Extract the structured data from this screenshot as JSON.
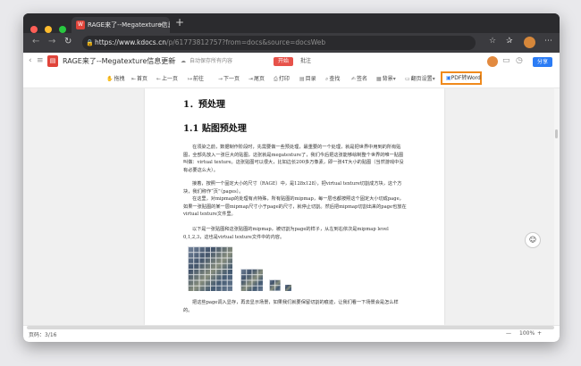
{
  "browser": {
    "tab_title": "RAGE来了--Megatexture信息更新",
    "tab_close": "×",
    "new_tab": "+",
    "url_main": "https://www.kdocs.cn",
    "url_rest": "/p/61773812757?from=docs&source=docsWeb"
  },
  "app": {
    "doc_title": "RAGE来了--Megatexture信息更新",
    "autosave": "自动保存所有内容",
    "open_label": "开始",
    "comment_label": "批注",
    "share_label": "分享"
  },
  "toolbar": {
    "items": [
      "拖拽",
      "首页",
      "上一页",
      "前往",
      "下一页",
      "尾页",
      "打印",
      "目录",
      "查找",
      "签名",
      "背景",
      "翻页设置"
    ],
    "pdf_to_word": "PDF转Word"
  },
  "document": {
    "heading1": "1．预处理",
    "heading2": "1.1 贴图预处理",
    "para1": "在须染之前，数据制作阶段时，先需要做一些预处理，最重要的一个处理，就是把世界中用到的所有贴图，全部先放入一张巨大的贴图，这张就是megatexture了，我们今后把这张能够绘制整个世界的唯一贴图叫做：virtual texture。这张贴图可以很大，比如边长200多万像素，即一张4T大小的贴图（当然游戏中没有必要这么大）。",
    "para2": "接着，按照一个固定大小的尺寸（RAGE）中，是128x128），把virtual texture切割成方块，这个方块，我们称作“页”（pages）。",
    "para3": "在这里，对mipmap的处理有点特殊，所有贴图的mipmap，每一层也都按照这个固定大小切成page，如果一张贴图的某一层mipmap尺寸小于page的尺寸，就停止切割。然后把mipmap切割出来的page也放在virtual texture文件里。",
    "para4": "以下是一张贴图和这张贴图的mipmap，被切割为page的样子，从左到右依次是mipmap level 0,1,2,3，这也是virtual texture文件中的内容。",
    "para5": "把这些page调入显存，再去显示场景，如果我们就要保留切割的痕迹，让我们看一下场景会是怎么样的。"
  },
  "status": {
    "page_info": "页码：3/16",
    "zoom_minus": "—",
    "zoom": "100%",
    "zoom_plus": "+"
  },
  "colors": {
    "accent_orange": "#f08a1c",
    "brand_red": "#e7524a",
    "share_blue": "#2b7cf5"
  }
}
